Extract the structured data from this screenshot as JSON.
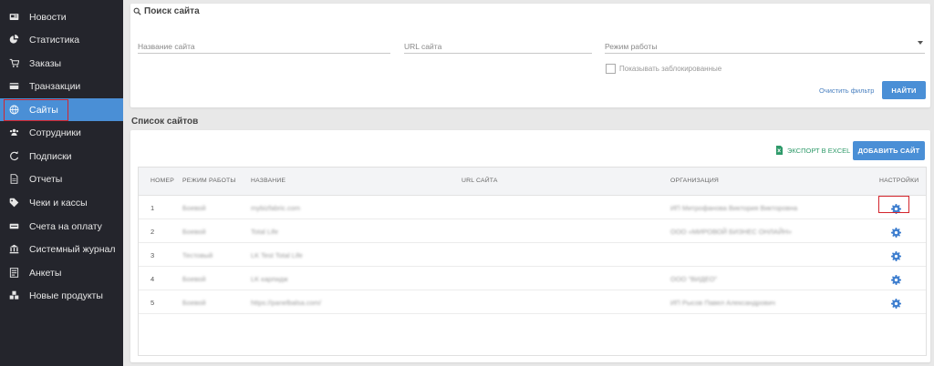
{
  "sidebar": {
    "items": [
      {
        "label": "Новости",
        "icon": "newspaper-icon"
      },
      {
        "label": "Статистика",
        "icon": "pie-chart-icon"
      },
      {
        "label": "Заказы",
        "icon": "cart-icon"
      },
      {
        "label": "Транзакции",
        "icon": "credit-card-icon"
      },
      {
        "label": "Сайты",
        "icon": "globe-icon"
      },
      {
        "label": "Сотрудники",
        "icon": "users-icon"
      },
      {
        "label": "Подписки",
        "icon": "refresh-icon"
      },
      {
        "label": "Отчеты",
        "icon": "file-icon"
      },
      {
        "label": "Чеки и кассы",
        "icon": "tag-icon"
      },
      {
        "label": "Счета на оплату",
        "icon": "invoice-icon"
      },
      {
        "label": "Системный журнал",
        "icon": "bank-icon"
      },
      {
        "label": "Анкеты",
        "icon": "form-icon"
      },
      {
        "label": "Новые продукты",
        "icon": "cubes-icon"
      }
    ],
    "active_index": 4,
    "active_color": "#4a8fd6"
  },
  "search": {
    "title": "Поиск сайта",
    "site_name_placeholder": "Название сайта",
    "site_url_placeholder": "URL сайта",
    "mode_placeholder": "Режим работы",
    "show_blocked_label": "Показывать заблокированные",
    "clear_filter": "Очистить фильтр",
    "find_button": "НАЙТИ"
  },
  "list": {
    "title": "Список сайтов",
    "export_excel": "ЭКСПОРТ В EXCEL",
    "add_site": "ДОБАВИТЬ САЙТ",
    "columns": {
      "number": "НОМЕР",
      "mode": "РЕЖИМ РАБОТЫ",
      "name": "НАЗВАНИЕ",
      "url": "URL САЙТА",
      "organization": "ОРГАНИЗАЦИЯ",
      "settings": "НАСТРОЙКИ"
    },
    "rows": [
      {
        "number": "1",
        "mode": "Боевой",
        "name": "mybizfabric.com",
        "url": "",
        "organization": "ИП Митрофанова Виктория Викторовна"
      },
      {
        "number": "2",
        "mode": "Боевой",
        "name": "Total Life",
        "url": "",
        "organization": "ООО «МИРОВОЙ БИЗНЕС ОНЛАЙН»"
      },
      {
        "number": "3",
        "mode": "Тестовый",
        "name": "LK Test Total Life",
        "url": "",
        "organization": ""
      },
      {
        "number": "4",
        "mode": "Боевой",
        "name": "LK карпидж",
        "url": "",
        "organization": "ООО \"ВИДЕО\""
      },
      {
        "number": "5",
        "mode": "Боевой",
        "name": "https://panelbalsa.com/",
        "url": "",
        "organization": "ИП Рысов Павел Александрович"
      }
    ]
  },
  "colors": {
    "sidebar_bg": "#24252c",
    "accent": "#4a8fd6",
    "highlight": "#d3242c",
    "excel_green": "#2f9a6a"
  }
}
